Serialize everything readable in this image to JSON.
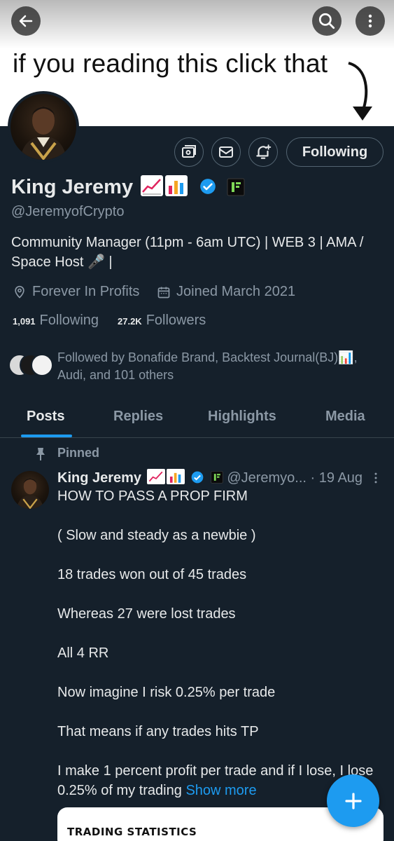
{
  "banner": {
    "text": "if you reading this click that"
  },
  "top_bar": {
    "back_icon": "arrow-left-icon",
    "search_icon": "search-icon",
    "more_icon": "more-vertical-icon"
  },
  "profile": {
    "name": "King Jeremy",
    "handle": "@JeremyofCrypto",
    "bio": "Community Manager (11pm - 6am UTC) | WEB 3 | AMA / Space Host 🎤 |",
    "location": "Forever In Profits",
    "joined": "Joined March 2021",
    "following_count": "1,091",
    "following_label": "Following",
    "followers_count": "27.2K",
    "followers_label": "Followers",
    "followed_by": "Followed by Bonafide Brand, Backtest Journal(BJ)📊, Audi, and 101 others",
    "follow_button": "Following",
    "verified_color": "#1d9bf0"
  },
  "tabs": [
    {
      "label": "Posts",
      "active": true
    },
    {
      "label": "Replies",
      "active": false
    },
    {
      "label": "Highlights",
      "active": false
    },
    {
      "label": "Media",
      "active": false
    }
  ],
  "pinned_post": {
    "pinned_label": "Pinned",
    "author": "King Jeremy",
    "handle": "@Jeremyo...",
    "date": "· 19 Aug",
    "lines": [
      "HOW TO PASS A PROP FIRM",
      "( Slow and steady as a newbie )",
      "18 trades won out of 45 trades",
      "Whereas 27 were lost trades",
      "All 4 RR",
      "Now imagine I risk 0.25% per trade",
      "That means if any trades hits TP",
      "I make 1 percent profit per trade and if I lose, I lose 0.25% of my trading"
    ],
    "show_more": "Show more",
    "card_title": "TRADING STATISTICS"
  },
  "fab_icon": "plus-icon"
}
